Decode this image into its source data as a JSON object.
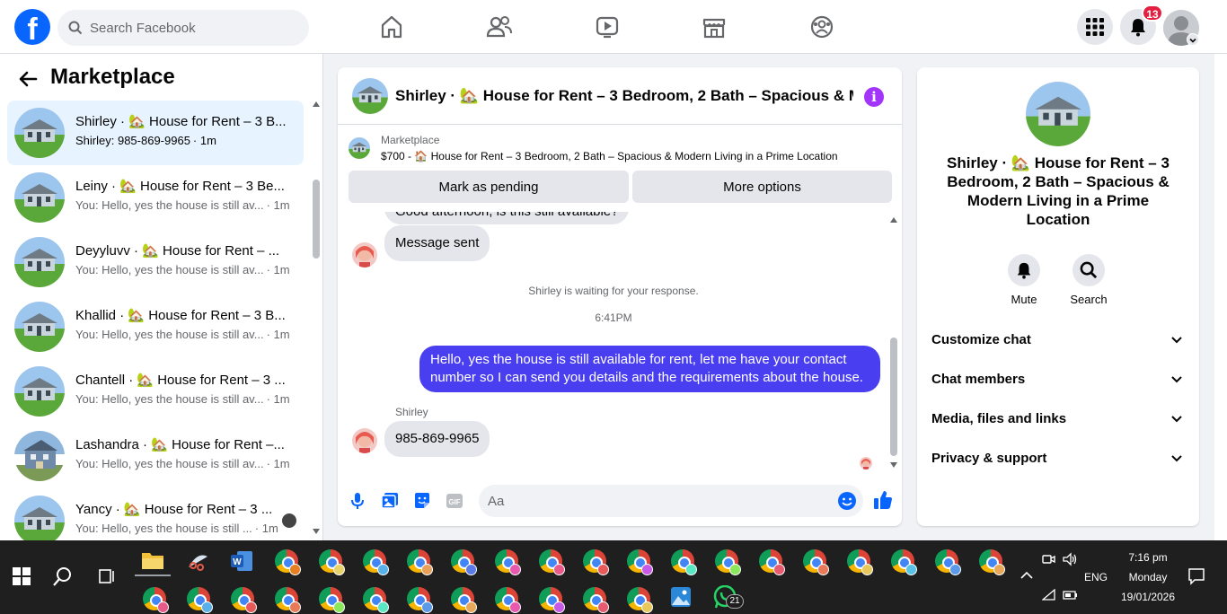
{
  "topbar": {
    "search_placeholder": "Search Facebook",
    "notifications_count": "13"
  },
  "sidebar": {
    "title": "Marketplace",
    "conversations": [
      {
        "name": "Shirley · 🏡 House for Rent – 3 B...",
        "preview": "Shirley: 985-869-9965",
        "time": "· 1m"
      },
      {
        "name": "Leiny · 🏡 House for Rent – 3 Be...",
        "preview": "You: Hello, yes the house is still av...",
        "time": "· 1m"
      },
      {
        "name": "Deyyluvv · 🏡 House for Rent – ...",
        "preview": "You: Hello, yes the house is still av...",
        "time": "· 1m"
      },
      {
        "name": "Khallid · 🏡 House for Rent – 3 B...",
        "preview": "You: Hello, yes the house is still av...",
        "time": "· 1m"
      },
      {
        "name": "Chantell · 🏡 House for Rent – 3 ...",
        "preview": "You: Hello, yes the house is still av...",
        "time": "· 1m"
      },
      {
        "name": "Lashandra · 🏡 House for Rent –...",
        "preview": "You: Hello, yes the house is still av...",
        "time": "· 1m"
      },
      {
        "name": "Yancy · 🏡 House for Rent – 3 ...",
        "preview": "You: Hello, yes the house is still ...",
        "time": "· 1m"
      }
    ]
  },
  "chat": {
    "title": "Shirley · 🏡 House for Rent – 3 Bedroom, 2 Bath – Spacious & M...",
    "marketplace_label": "Marketplace",
    "listing": "$700 - 🏠 House for Rent – 3 Bedroom, 2 Bath – Spacious & Modern Living in a Prime Location",
    "mark_pending": "Mark as pending",
    "more_options": "More options",
    "cut_message": "Good afternoon, is this still available?",
    "message_sent": "Message sent",
    "waiting": "Shirley is waiting for your response.",
    "timestamp": "6:41PM",
    "outgoing": "Hello, yes the house is still available for rent, let me have your contact number so I can send you details and the requirements about the house.",
    "sender": "Shirley",
    "incoming_phone": "985-869-9965",
    "composer_placeholder": "Aa"
  },
  "rpane": {
    "title": "Shirley · 🏡 House for Rent – 3 Bedroom, 2 Bath – Spacious & Modern Living in a Prime Location",
    "mute": "Mute",
    "search": "Search",
    "rows": [
      "Customize chat",
      "Chat members",
      "Media, files and links",
      "Privacy & support"
    ]
  },
  "taskbar": {
    "lang": "ENG",
    "time": "7:16 pm",
    "day": "Monday",
    "date": "19/01/2026",
    "whatsapp_count": "21"
  },
  "colors": {
    "brand": "#0866ff",
    "outgoing_bubble": "#4a3ff0",
    "info_purple": "#a334fa",
    "badge_red": "#e41e3f"
  }
}
